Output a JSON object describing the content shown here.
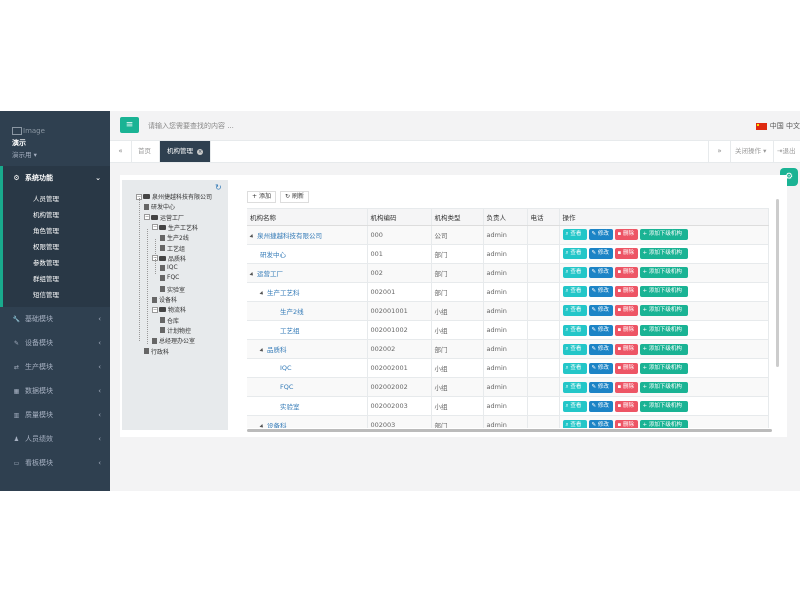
{
  "sidebar": {
    "profile": {
      "image_alt": "Image",
      "name": "演示",
      "role": "演示用"
    },
    "active_group": {
      "label": "系统功能",
      "icon": "gear-icon",
      "items": [
        "人员管理",
        "机构管理",
        "角色管理",
        "权限管理",
        "参数管理",
        "群组管理",
        "短信管理"
      ]
    },
    "groups": [
      {
        "label": "基础模块",
        "icon": "wrench-icon"
      },
      {
        "label": "设备模块",
        "icon": "tool-icon"
      },
      {
        "label": "生产模块",
        "icon": "share-icon"
      },
      {
        "label": "数据模块",
        "icon": "database-icon"
      },
      {
        "label": "质量模块",
        "icon": "bar-chart-icon"
      },
      {
        "label": "人员绩效",
        "icon": "user-icon"
      },
      {
        "label": "看板模块",
        "icon": "desktop-icon"
      }
    ]
  },
  "header": {
    "search_placeholder": "请输入您需要查找的内容 ...",
    "lang": "中国 中文"
  },
  "tabs": {
    "home": "首页",
    "active": "机构管理",
    "close_ops": "关闭操作",
    "logout": "退出"
  },
  "tree": {
    "root": "泉州捷越科技有限公司",
    "nodes": [
      "研发中心",
      "运营工厂",
      "生产工艺科",
      "生产2线",
      "工艺组",
      "品质科",
      "IQC",
      "FQC",
      "实验室",
      "设备科",
      "物流科",
      "仓库",
      "计划物控",
      "总经理办公室",
      "行政科"
    ]
  },
  "toolbar": {
    "add": "添加",
    "refresh": "刷新"
  },
  "grid": {
    "headers": [
      "机构名称",
      "机构编码",
      "机构类型",
      "负责人",
      "电话",
      "操作"
    ],
    "ops": {
      "view": "查看",
      "edit": "修改",
      "del": "删除",
      "add_sub": "添加下级机构"
    },
    "rows": [
      {
        "name": "泉州捷越科技有限公司",
        "code": "000",
        "type": "公司",
        "head": "admin",
        "phone": ""
      },
      {
        "name": "研发中心",
        "code": "001",
        "type": "部门",
        "head": "admin",
        "phone": ""
      },
      {
        "name": "运营工厂",
        "code": "002",
        "type": "部门",
        "head": "admin",
        "phone": ""
      },
      {
        "name": "生产工艺科",
        "code": "002001",
        "type": "部门",
        "head": "admin",
        "phone": ""
      },
      {
        "name": "生产2线",
        "code": "002001001",
        "type": "小组",
        "head": "admin",
        "phone": ""
      },
      {
        "name": "工艺组",
        "code": "002001002",
        "type": "小组",
        "head": "admin",
        "phone": ""
      },
      {
        "name": "品质科",
        "code": "002002",
        "type": "部门",
        "head": "admin",
        "phone": ""
      },
      {
        "name": "IQC",
        "code": "002002001",
        "type": "小组",
        "head": "admin",
        "phone": ""
      },
      {
        "name": "FQC",
        "code": "002002002",
        "type": "小组",
        "head": "admin",
        "phone": ""
      },
      {
        "name": "实验室",
        "code": "002002003",
        "type": "小组",
        "head": "admin",
        "phone": ""
      },
      {
        "name": "设备科",
        "code": "002003",
        "type": "部门",
        "head": "admin",
        "phone": ""
      }
    ]
  }
}
